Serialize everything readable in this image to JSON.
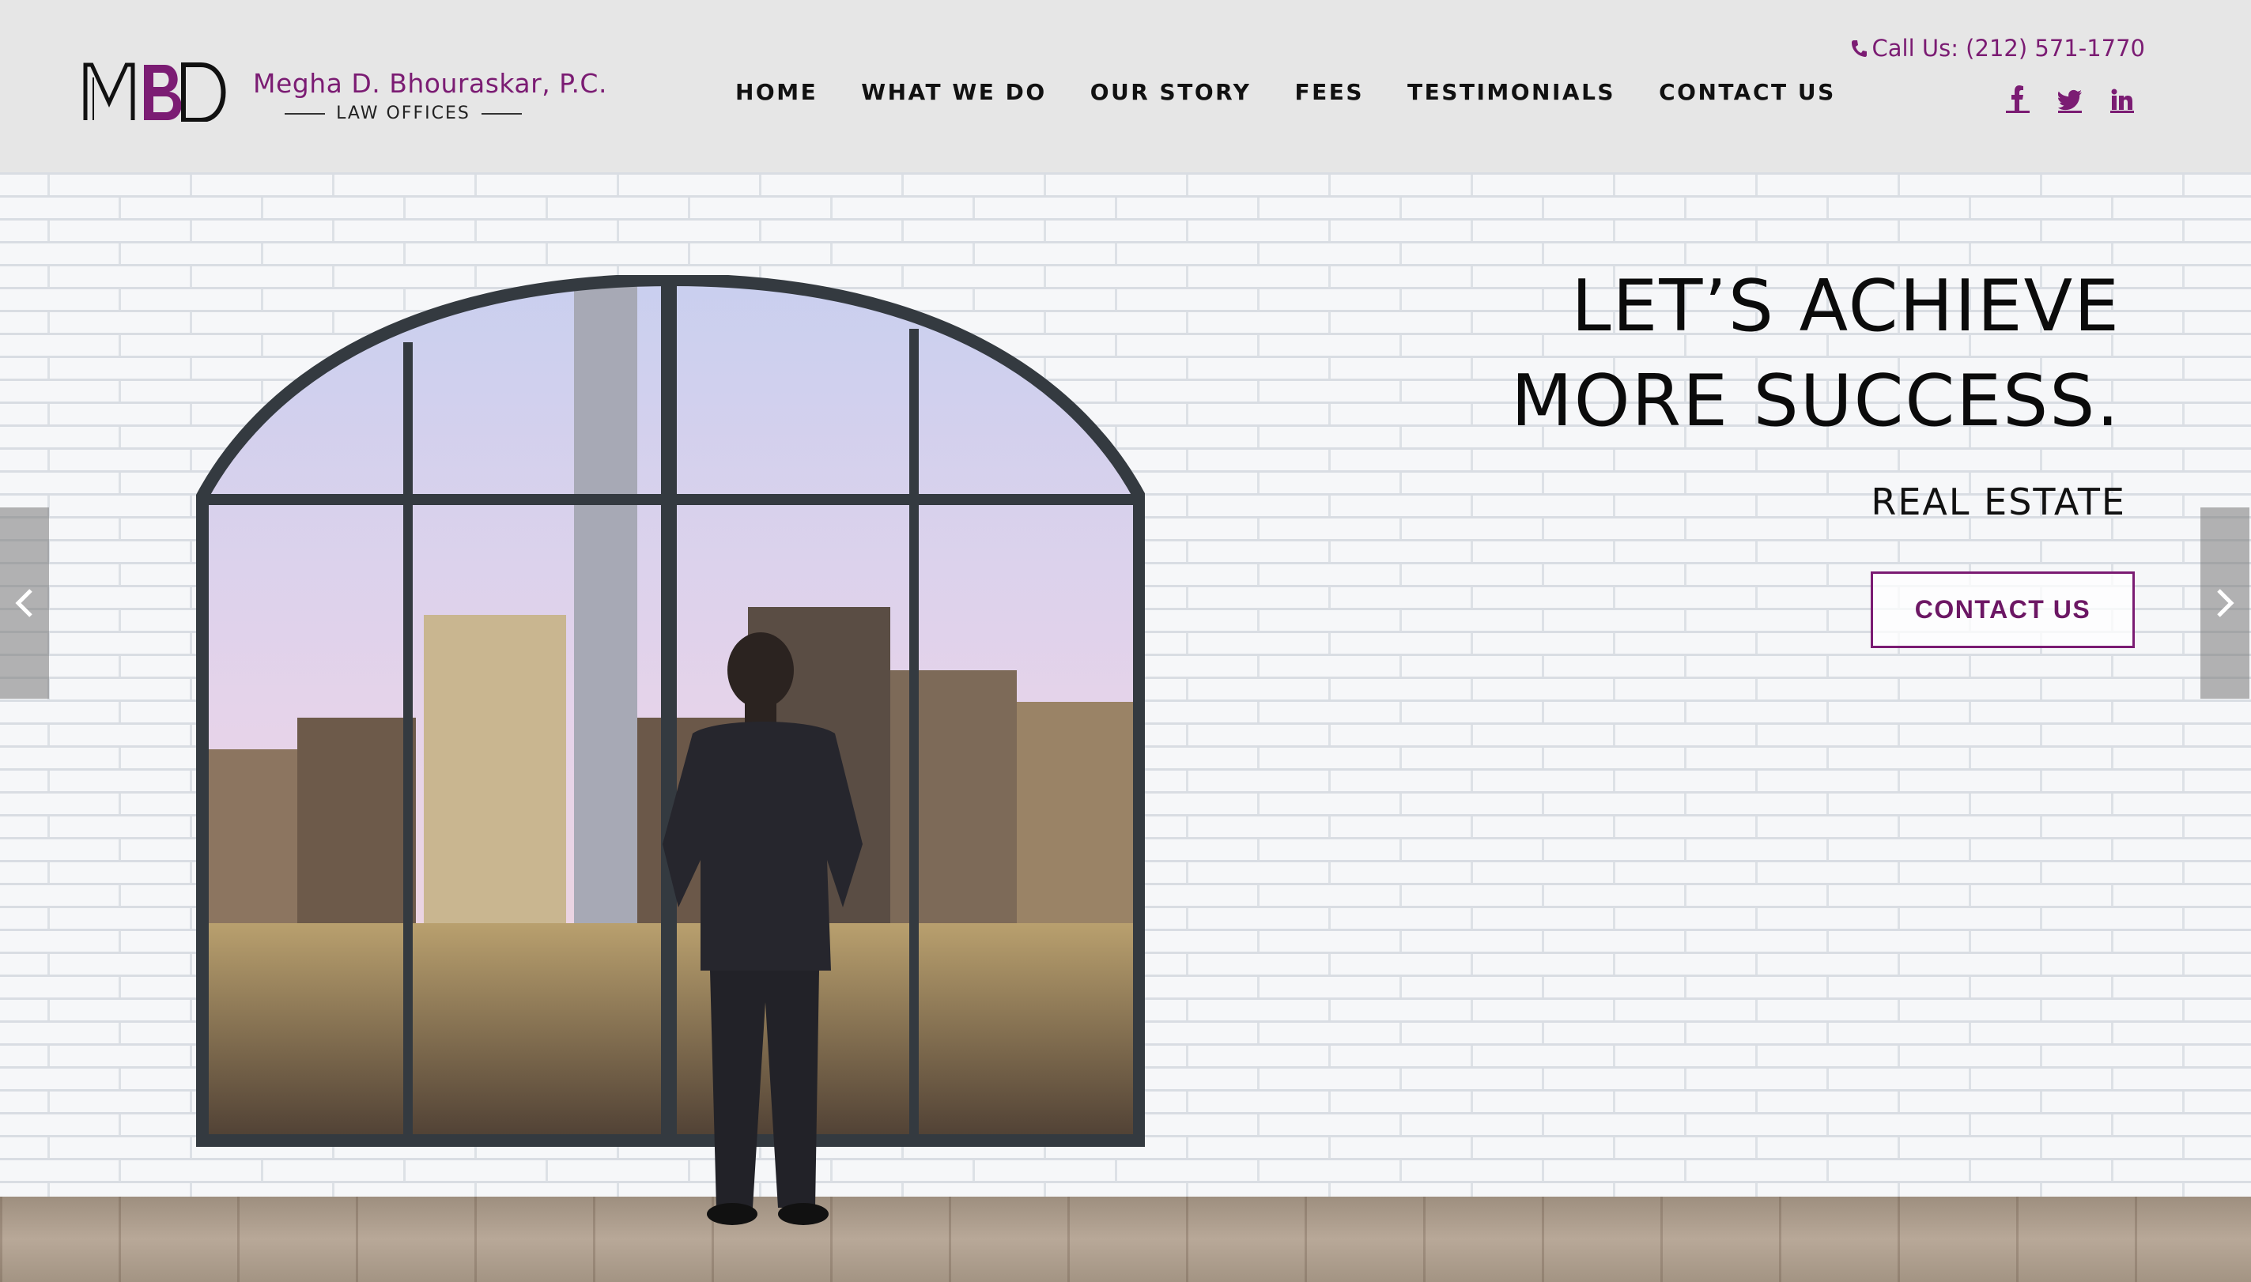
{
  "brand": {
    "logo_text": "MBD",
    "name": "Megha D. Bhouraskar, P.C.",
    "subtitle": "LAW OFFICES"
  },
  "nav": {
    "items": [
      {
        "label": "HOME"
      },
      {
        "label": "WHAT WE DO"
      },
      {
        "label": "OUR STORY"
      },
      {
        "label": "FEES"
      },
      {
        "label": "TESTIMONIALS"
      },
      {
        "label": "CONTACT US"
      }
    ]
  },
  "contact": {
    "phone_label": "Call Us: (212) 571-1770"
  },
  "social": {
    "icons": [
      "facebook-icon",
      "twitter-icon",
      "linkedin-icon"
    ]
  },
  "hero": {
    "headline_line1": "LET’S ACHIEVE",
    "headline_line2": "MORE SUCCESS.",
    "tagline": "REAL ESTATE",
    "cta_label": "CONTACT US"
  },
  "colors": {
    "brand_purple": "#7b1c73",
    "header_bg": "#e6e6e6",
    "window_frame": "#343a40"
  }
}
